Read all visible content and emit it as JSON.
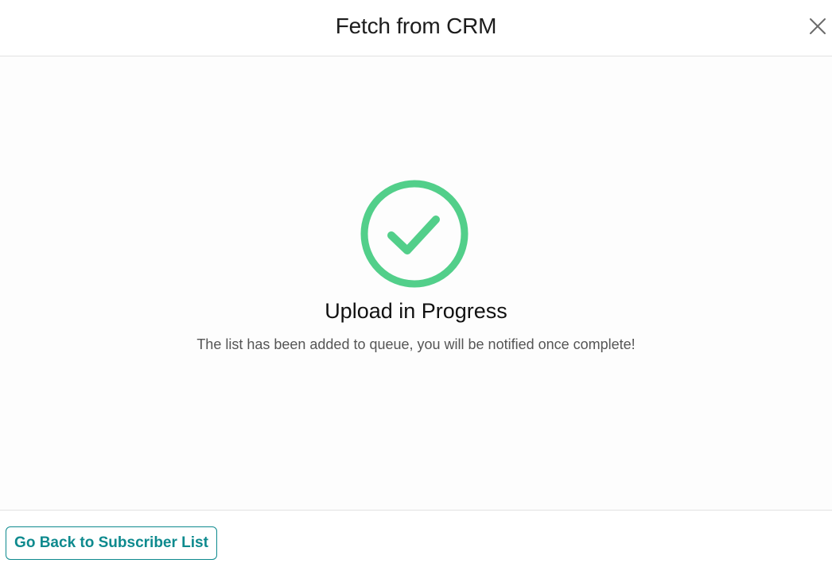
{
  "header": {
    "title": "Fetch from CRM",
    "close_icon": "close-icon"
  },
  "status": {
    "icon": "check-circle-icon",
    "icon_color": "#52cf8a",
    "title": "Upload in Progress",
    "message": "The list has been added to queue, you will be notified once complete!"
  },
  "footer": {
    "back_button_label": "Go Back to Subscriber List",
    "accent_color": "#0e8a8e"
  }
}
